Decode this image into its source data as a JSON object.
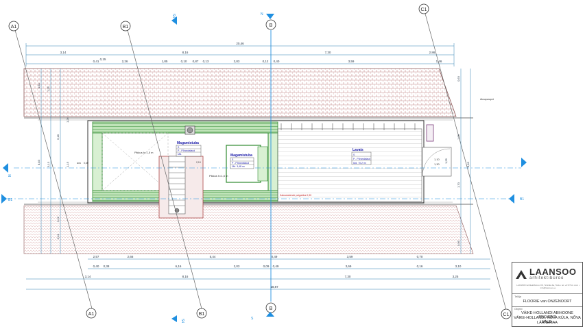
{
  "grid_labels": {
    "a1_top": "A1",
    "b1_top": "B1",
    "b_top": "B",
    "c1_top": "C1",
    "a1_bottom": "A1",
    "b1_bottom": "B1",
    "b_bottom": "B",
    "c1_bottom": "C1"
  },
  "section_markers": {
    "n_top": "N",
    "n_left": "N",
    "s_bottom": "S",
    "b1_left": "B1",
    "b1_right": "B1",
    "small_top": "S4",
    "small_bottom": "S4"
  },
  "dims": {
    "overall_top": "20,46",
    "top_row2": [
      "3,14",
      "8,16",
      "7,30",
      "2,86"
    ],
    "top_row3": [
      "0,41",
      "0,15",
      "2,26",
      "1,85",
      "0,10",
      "0,87",
      "0,13",
      "3,83",
      "0,12",
      "0,40",
      "3,59",
      "1,46"
    ],
    "bottom_row1": [
      "2,57",
      "2,66",
      "5,44",
      "0,49",
      "3,59",
      "0,70"
    ],
    "bottom_row2": [
      "0,40",
      "0,38",
      "6,16",
      "2,03",
      "0,09",
      "0,49",
      "3,69",
      "0,16",
      "3,10"
    ],
    "bottom_row3": [
      "3,14",
      "8,16",
      "7,30",
      "3,25"
    ],
    "overall_bottom": "18,87",
    "left_vert": [
      "0,41",
      "1,25",
      "6,18",
      "3,13",
      "3,12",
      "0,41",
      "8,83",
      "1,26",
      "1,15"
    ],
    "right_vert": [
      "0,63",
      "1,09",
      "1,25",
      "1,70",
      "8,83",
      "0,99"
    ]
  },
  "rooms": {
    "room1": {
      "name": "Magamistuba",
      "rows": [
        "S",
        "P - Põrandalaud",
        "Üld."
      ]
    },
    "room2": {
      "name": "Magamistuba",
      "rows": [
        "S",
        "P - Põrandalaud",
        "Üld.    3,48 m²"
      ]
    },
    "room3": {
      "name": "Lavats",
      "rows": [
        "S",
        "P - Põrandalaud",
        "Üld.    70,2 m²"
      ]
    }
  },
  "annotations": {
    "height_left": "Pikkus h=1,5 m",
    "height_mid": "Pikkus h=1,5 m",
    "code_left": "0,60",
    "code_mid": "2,10",
    "red_note": "Katuseakende paigaldus 0,90",
    "right_note": "Aknaparapet",
    "door_right": [
      "1,10",
      "1,30"
    ],
    "hatch_label": "ava"
  },
  "title_block": {
    "brand": "LAANSOO",
    "sub": "arhitektibüroo",
    "tiny": "LAANSOO arhitektibüroo OÜ, Tehnika 4a, Tartu • tel. +372 5xx xxxx • info@laansoo.ee",
    "caption1": "Tellija",
    "value1": "FLOORIE van ONZENOORT",
    "caption2": "Objekt",
    "value2": [
      "VÄIKE-HOLLANDI ABIHOONE PROJEKT",
      "VÄIKE-HOLLANDI, NÕVA KÜLA, NÕVA VALD,",
      "LÄÄNEMAA"
    ]
  },
  "colors": {
    "roof_red": "#c89090",
    "dim_blue": "#2a7fb0",
    "marker_blue": "#1f8fe0",
    "wall_green": "#3a9a3a",
    "grid_gray": "#777777"
  }
}
